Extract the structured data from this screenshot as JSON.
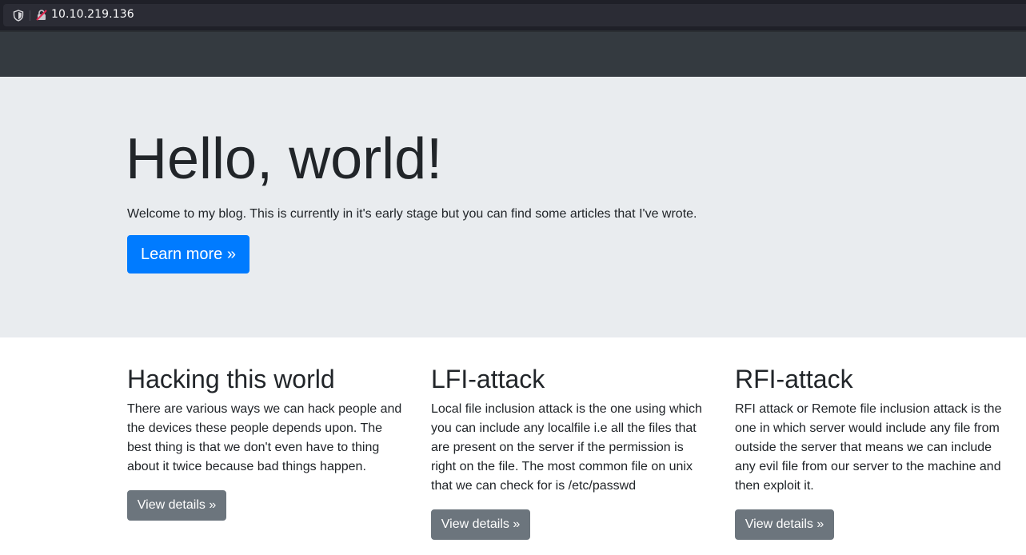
{
  "browser": {
    "url": "10.10.219.136",
    "icons": [
      "shield-icon",
      "insecure-lock-icon"
    ]
  },
  "hero": {
    "title": "Hello, world!",
    "text": "Welcome to my blog. This is currently in it's early stage but you can find some articles that I've wrote.",
    "button_label": "Learn more »"
  },
  "columns": [
    {
      "heading": "Hacking this world",
      "text": "There are various ways we can hack people and the devices these people depends upon. The best thing is that we don't even have to thing about it twice because bad things happen.",
      "button_label": "View details »"
    },
    {
      "heading": "LFI-attack",
      "text": "Local file inclusion attack is the one using which you can include any localfile i.e all the files that are present on the server if the permission is right on the file. The most common file on unix that we can check for is /etc/passwd",
      "button_label": "View details »"
    },
    {
      "heading": "RFI-attack",
      "text": "RFI attack or Remote file inclusion attack is the one in which server would include any file from outside the server that means we can include any evil file from our server to the machine and then exploit it.",
      "button_label": "View details »"
    }
  ],
  "colors": {
    "navbar": "#343a40",
    "jumbotron": "#e9ecef",
    "primary": "#007bff",
    "secondary": "#6c757d"
  }
}
